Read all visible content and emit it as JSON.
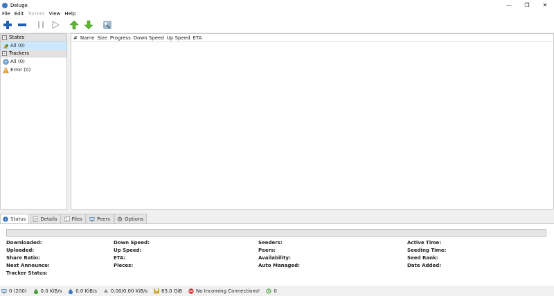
{
  "window": {
    "title": "Deluge"
  },
  "menu": [
    "File",
    "Edit",
    "Torrent",
    "View",
    "Help"
  ],
  "sidebar": {
    "states_header": "States",
    "states": [
      {
        "label": "All (0)",
        "icon": "all-states-icon",
        "selected": true
      }
    ],
    "trackers_header": "Trackers",
    "trackers": [
      {
        "label": "All (0)",
        "icon": "tracker-globe-icon"
      },
      {
        "label": "Error (0)",
        "icon": "warning-icon"
      }
    ]
  },
  "torrent_columns": [
    "#",
    "Name",
    "Size",
    "Progress",
    "Down Speed",
    "Up Speed",
    "ETA"
  ],
  "tabs": [
    {
      "label": "Status",
      "icon": "info-icon",
      "active": true
    },
    {
      "label": "Details",
      "icon": "details-icon"
    },
    {
      "label": "Files",
      "icon": "files-icon"
    },
    {
      "label": "Peers",
      "icon": "peers-icon"
    },
    {
      "label": "Options",
      "icon": "options-icon"
    }
  ],
  "status": {
    "progress": 0,
    "col1": [
      "Downloaded:",
      "Uploaded:",
      "Share Ratio:",
      "Next Announce:",
      "Tracker Status:"
    ],
    "col2": [
      "Down Speed:",
      "Up Speed:",
      "ETA:",
      "Pieces:"
    ],
    "col3": [
      "Seeders:",
      "Peers:",
      "Availability:",
      "Auto Managed:"
    ],
    "col4": [
      "Active Time:",
      "Seeding Time:",
      "Seed Rank:",
      "Date Added:"
    ]
  },
  "statusbar": {
    "connections": "0 (200)",
    "down": "0.0 KiB/s",
    "up": "0.0 KiB/s",
    "protocol": "0.00/0.00 KiB/s",
    "disk": "63.0 GiB",
    "incoming": "No Incoming Connections!",
    "dht": "0"
  },
  "colors": {
    "accent": "#3b79c7",
    "selection": "#cce8ff",
    "add": "#1e5fb4",
    "queue": "#5cb82e"
  }
}
